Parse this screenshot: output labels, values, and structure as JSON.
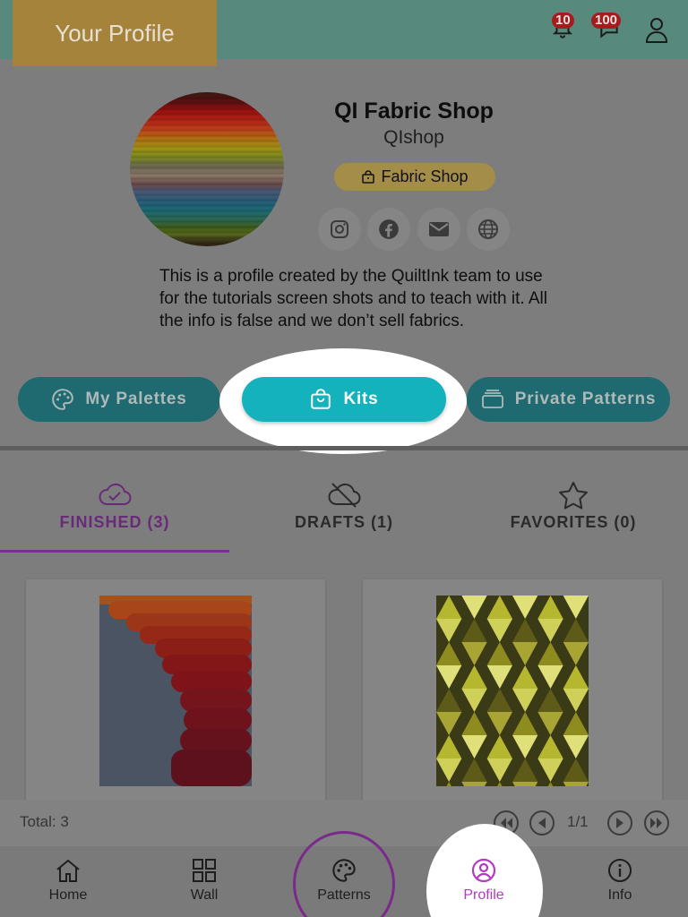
{
  "header": {
    "title": "Your Profile",
    "notifications_badge": "10",
    "messages_badge": "100"
  },
  "profile": {
    "name": "QI Fabric Shop",
    "handle": "QIshop",
    "shop_chip": "Fabric Shop",
    "bio": "This is a profile created by the QuiltInk team to use for the tutorials screen shots and to teach with it. All the info is false and we don’t sell fabrics.",
    "social": [
      "instagram-icon",
      "facebook-icon",
      "email-icon",
      "website-icon"
    ]
  },
  "actions": {
    "palettes": "My Palettes",
    "kits": "Kits",
    "private": "Private Patterns"
  },
  "tabs": [
    {
      "label": "FINISHED (3)",
      "icon": "cloud-check-icon",
      "active": true
    },
    {
      "label": "DRAFTS (1)",
      "icon": "cloud-off-icon",
      "active": false
    },
    {
      "label": "FAVORITES (0)",
      "icon": "star-icon",
      "active": false
    }
  ],
  "footer": {
    "total": "Total: 3",
    "page": "1/1"
  },
  "nav": {
    "home": "Home",
    "wall": "Wall",
    "patterns": "Patterns",
    "profile": "Profile",
    "info": "Info"
  },
  "colors": {
    "header": "#58897d",
    "accent_teal": "#14b2bd",
    "accent_purple": "#7a2f8c",
    "chip": "#a48d49",
    "badge": "#a41c1c"
  }
}
